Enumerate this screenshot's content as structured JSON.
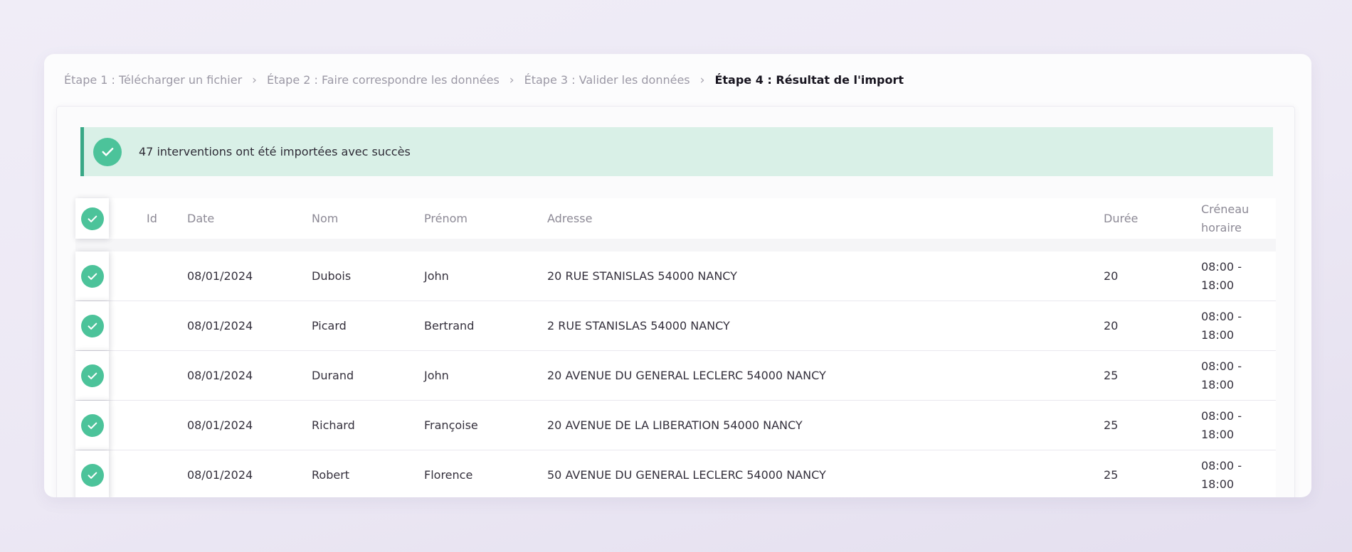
{
  "colors": {
    "green": "#4CC39A",
    "banner_bg": "#D9F0E7",
    "banner_border": "#38A886",
    "page_bg": "#ECE8F4"
  },
  "breadcrumb": {
    "separator": "›",
    "items": [
      {
        "label": "Étape 1 : Télécharger un fichier",
        "active": false
      },
      {
        "label": "Étape 2 : Faire correspondre les données",
        "active": false
      },
      {
        "label": "Étape 3 : Valider les données",
        "active": false
      },
      {
        "label": "Étape 4 : Résultat de l'import",
        "active": true
      }
    ]
  },
  "banner": {
    "icon": "check-circle-icon",
    "message": "47 interventions ont été importées avec succès"
  },
  "table": {
    "headers": {
      "status": "",
      "id": "Id",
      "date": "Date",
      "nom": "Nom",
      "prenom": "Prénom",
      "adresse": "Adresse",
      "duree": "Durée",
      "creneau": "Créneau horaire"
    },
    "rows": [
      {
        "status_icon": "check-circle-icon",
        "id": "",
        "date": "08/01/2024",
        "nom": "Dubois",
        "prenom": "John",
        "adresse": "20 RUE STANISLAS 54000 NANCY",
        "duree": "20",
        "creneau": "08:00 - 18:00"
      },
      {
        "status_icon": "check-circle-icon",
        "id": "",
        "date": "08/01/2024",
        "nom": "Picard",
        "prenom": "Bertrand",
        "adresse": "2 RUE STANISLAS 54000 NANCY",
        "duree": "20",
        "creneau": "08:00 - 18:00"
      },
      {
        "status_icon": "check-circle-icon",
        "id": "",
        "date": "08/01/2024",
        "nom": "Durand",
        "prenom": "John",
        "adresse": "20 AVENUE DU GENERAL LECLERC 54000 NANCY",
        "duree": "25",
        "creneau": "08:00 - 18:00"
      },
      {
        "status_icon": "check-circle-icon",
        "id": "",
        "date": "08/01/2024",
        "nom": "Richard",
        "prenom": "Françoise",
        "adresse": "20 AVENUE DE LA LIBERATION 54000 NANCY",
        "duree": "25",
        "creneau": "08:00 - 18:00"
      },
      {
        "status_icon": "check-circle-icon",
        "id": "",
        "date": "08/01/2024",
        "nom": "Robert",
        "prenom": "Florence",
        "adresse": "50 AVENUE DU GENERAL LECLERC 54000 NANCY",
        "duree": "25",
        "creneau": "08:00 - 18:00"
      }
    ]
  }
}
